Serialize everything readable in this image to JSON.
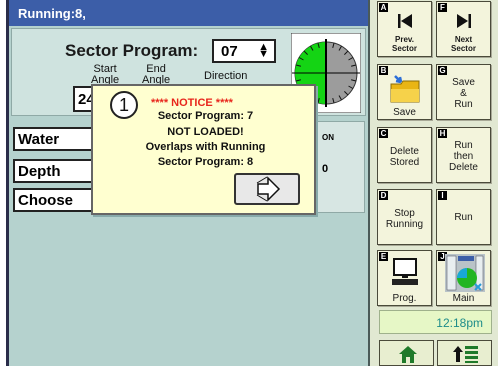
{
  "status_bar": {
    "text": "Running:8,"
  },
  "program": {
    "sector_label": "Sector Program:",
    "sector_value": "07",
    "start_angle_label": "Start\nAngle",
    "end_angle_label": "End\nAngle",
    "direction_label": "Direction",
    "start_angle_value": "24"
  },
  "rows": [
    {
      "label": "Water"
    },
    {
      "label": "Depth"
    },
    {
      "label": "Choose"
    }
  ],
  "table": {
    "on_header": "ON",
    "cell_value": "0"
  },
  "notice": {
    "number": "1",
    "title": "**** NOTICE ****",
    "line1": "Sector Program:  7",
    "line2": "NOT LOADED!",
    "line3": "Overlaps with Running",
    "line4": "Sector Program:  8"
  },
  "softkeys": [
    {
      "letter": "A",
      "label": "Prev.\nSector",
      "icon": "skip-previous-icon"
    },
    {
      "letter": "F",
      "label": "Next\nSector",
      "icon": "skip-next-icon"
    },
    {
      "letter": "B",
      "label": "Save",
      "icon": "folder-save-icon"
    },
    {
      "letter": "G",
      "label": "Save\n&\nRun",
      "icon": ""
    },
    {
      "letter": "C",
      "label": "Delete\nStored",
      "icon": ""
    },
    {
      "letter": "H",
      "label": "Run\nthen\nDelete",
      "icon": ""
    },
    {
      "letter": "D",
      "label": "Stop\nRunning",
      "icon": ""
    },
    {
      "letter": "I",
      "label": "Run",
      "icon": ""
    },
    {
      "letter": "E",
      "label": "Prog.",
      "icon": "computer-icon"
    },
    {
      "letter": "J",
      "label": "Main",
      "icon": "main-screen-icon"
    }
  ],
  "clock": "12:18pm",
  "bottom": {
    "home_icon": "home-icon",
    "up_icon": "up-arrow-list-icon"
  },
  "colors": {
    "status_bar": "#3c5ea8",
    "panel": "#b5d2ce",
    "notice_bg": "#ffffd0",
    "notice_title": "#e8261c",
    "dial_green": "#14d414",
    "clock_text": "#1d8c8a"
  }
}
